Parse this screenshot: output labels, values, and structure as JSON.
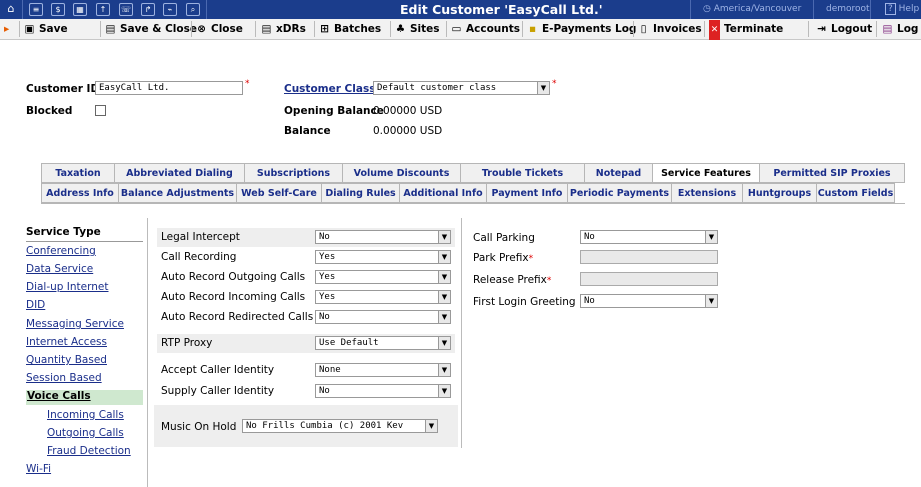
{
  "window": {
    "title": "Edit Customer 'EasyCall Ltd.'",
    "timezone": "America/Vancouver",
    "user": "demoroot",
    "help": "Help",
    "icons": [
      "home-icon",
      "list-icon",
      "dollar-icon",
      "grid-icon",
      "upload-icon",
      "phone-icon",
      "chart-icon",
      "search-icon"
    ]
  },
  "toolbar": {
    "save": "Save",
    "save_close": "Save & Close",
    "close": "Close",
    "xdrs": "xDRs",
    "batches": "Batches",
    "sites": "Sites",
    "accounts": "Accounts",
    "epayments": "E-Payments Log",
    "invoices": "Invoices",
    "terminate": "Terminate",
    "logout": "Logout",
    "log": "Log"
  },
  "customer": {
    "id_label": "Customer ID",
    "id_value": "EasyCall Ltd.",
    "blocked_label": "Blocked",
    "class_label": "Customer Class",
    "class_value": "Default customer class",
    "opening_label": "Opening Balance",
    "opening_value": "0.00000 USD",
    "balance_label": "Balance",
    "balance_value": "0.00000 USD"
  },
  "tabs_row1": [
    "Taxation",
    "Abbreviated Dialing",
    "Subscriptions",
    "Volume Discounts",
    "Trouble Tickets",
    "Notepad",
    "Service Features",
    "Permitted SIP Proxies"
  ],
  "tabs_row2": [
    "Address Info",
    "Balance Adjustments",
    "Web Self-Care",
    "Dialing Rules",
    "Additional Info",
    "Payment Info",
    "Periodic Payments",
    "Extensions",
    "Huntgroups",
    "Custom Fields"
  ],
  "sidebar": {
    "header": "Service Type",
    "items": [
      "Conferencing",
      "Data Service",
      "Dial-up Internet",
      "DID",
      "Messaging Service",
      "Internet Access",
      "Quantity Based",
      "Session Based",
      "Voice Calls"
    ],
    "sub_items": [
      "Incoming Calls",
      "Outgoing Calls",
      "Fraud Detection"
    ],
    "last": "Wi-Fi"
  },
  "features": [
    {
      "label": "Legal Intercept",
      "value": "No"
    },
    {
      "label": "Call Recording",
      "value": "Yes"
    },
    {
      "label": "Auto Record Outgoing Calls",
      "value": "Yes"
    },
    {
      "label": "Auto Record Incoming Calls",
      "value": "Yes"
    },
    {
      "label": "Auto Record Redirected Calls",
      "value": "No"
    },
    {
      "label": "RTP Proxy",
      "value": "Use Default"
    },
    {
      "label": "Accept Caller Identity",
      "value": "None"
    },
    {
      "label": "Supply Caller Identity",
      "value": "No"
    }
  ],
  "music_on_hold": {
    "label": "Music On Hold",
    "value": "No Frills Cumbia (c) 2001 Kev"
  },
  "right": {
    "call_parking_label": "Call Parking",
    "call_parking_value": "No",
    "park_prefix_label": "Park Prefix",
    "release_prefix_label": "Release Prefix",
    "first_login_label": "First Login Greeting",
    "first_login_value": "No"
  }
}
